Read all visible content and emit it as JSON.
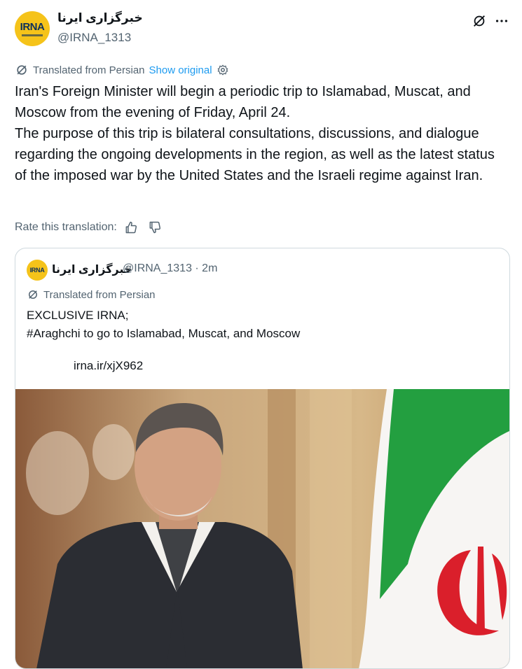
{
  "author": {
    "display_name": "خبرگزاری ایرنا",
    "handle": "@IRNA_1313",
    "avatar_text": "IRNA"
  },
  "translation": {
    "label": "Translated from Persian",
    "show_original": "Show original"
  },
  "tweet": {
    "paragraph_1": "Iran's Foreign Minister will begin a periodic trip to Islamabad, Muscat, and Moscow from the evening of Friday, April 24.",
    "paragraph_2": "The purpose of this trip is bilateral consultations, discussions, and dialogue regarding the ongoing developments in the region, as well as the latest status of the imposed war by the United States and the Israeli regime against Iran."
  },
  "rate": {
    "label": "Rate this translation:"
  },
  "quote": {
    "display_name": "خبرگزاری ایرنا",
    "meta": "@IRNA_1313 · 2m",
    "avatar_text": "IRNA",
    "translated_label": "Translated from Persian",
    "line_1": "EXCLUSIVE IRNA;",
    "line_2": "#Araghchi to go to Islamabad, Muscat, and Moscow",
    "link": "irna.ir/xjX962"
  },
  "icons": {
    "top_right": [
      "grok-icon",
      "more-options-icon"
    ],
    "translation": "translate-icon",
    "settings": "settings-gear-icon",
    "rate": [
      "thumbs-up-icon",
      "thumbs-down-icon"
    ]
  },
  "colors": {
    "link": "#1d9bf0",
    "secondary_text": "#536471",
    "border": "#cfd9de",
    "avatar_bg": "#f5c31a"
  }
}
